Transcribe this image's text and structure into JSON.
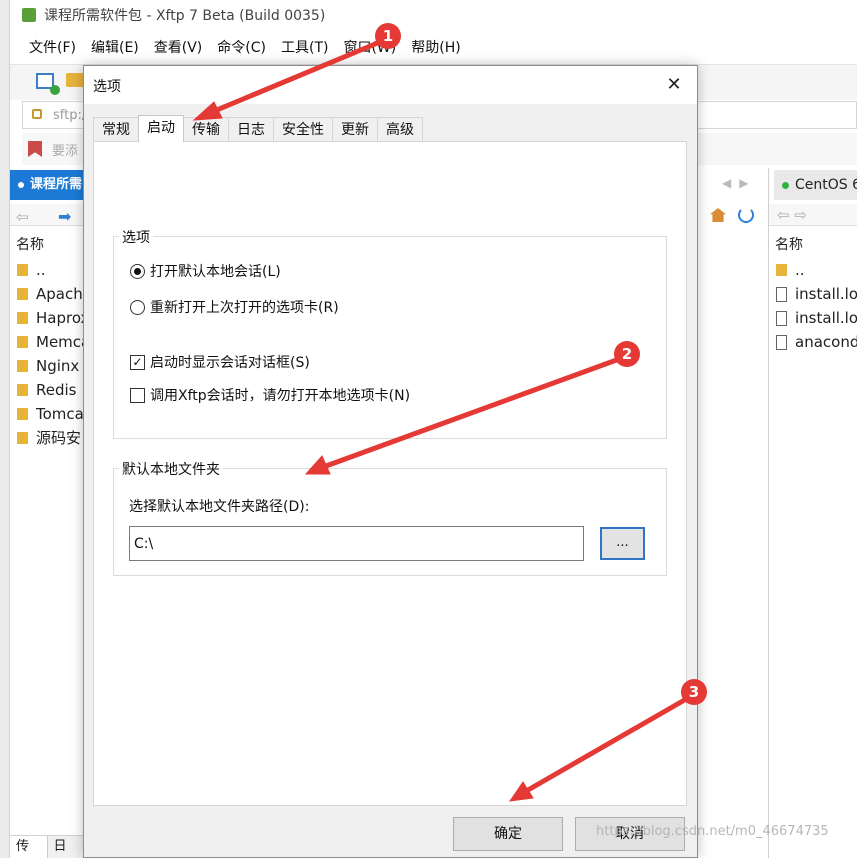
{
  "window": {
    "title": "课程所需软件包 - Xftp 7 Beta (Build 0035)"
  },
  "menu": [
    "文件(F)",
    "编辑(E)",
    "查看(V)",
    "命令(C)",
    "工具(T)",
    "窗口(W)",
    "帮助(H)"
  ],
  "address_bar": {
    "text": "sftp:/"
  },
  "hint_bar": {
    "text": "要添"
  },
  "left_panel": {
    "tab_label": "课程所需",
    "header": "名称",
    "items": [
      "..",
      "Apache",
      "Haproxy",
      "Memca",
      "Nginx",
      "Redis",
      "Tomcat",
      "源码安"
    ],
    "bottom_tabs": [
      "传输",
      "日志"
    ]
  },
  "right_panel": {
    "tab_label": "CentOS 6",
    "header": "名称",
    "items": [
      {
        "name": "..",
        "type": "folder"
      },
      {
        "name": "install.log",
        "type": "file"
      },
      {
        "name": "install.log",
        "type": "file"
      },
      {
        "name": "anaconda",
        "type": "file"
      }
    ]
  },
  "dialog": {
    "title": "选项",
    "close_glyph": "✕",
    "tabs": [
      "常规",
      "启动",
      "传输",
      "日志",
      "安全性",
      "更新",
      "高级"
    ],
    "active_tab_index": 1,
    "options_group": {
      "label": "选项",
      "radio_open_local": {
        "label": "打开默认本地会话(L)",
        "checked": true
      },
      "radio_reopen_tabs": {
        "label": "重新打开上次打开的选项卡(R)",
        "checked": false
      },
      "check_show_session_dialog": {
        "label": "启动时显示会话对话框(S)",
        "checked": true
      },
      "check_no_local_tab": {
        "label": "调用Xftp会话时，请勿打开本地选项卡(N)",
        "checked": false
      }
    },
    "folder_group": {
      "label": "默认本地文件夹",
      "path_label": "选择默认本地文件夹路径(D):",
      "path_value": "C:\\",
      "browse_label": "..."
    },
    "ok_label": "确定",
    "cancel_label": "取消"
  },
  "annotations": {
    "badges": [
      "1",
      "2",
      "3"
    ],
    "color": "#e53935"
  },
  "watermark": "https://blog.csdn.net/m0_46674735"
}
